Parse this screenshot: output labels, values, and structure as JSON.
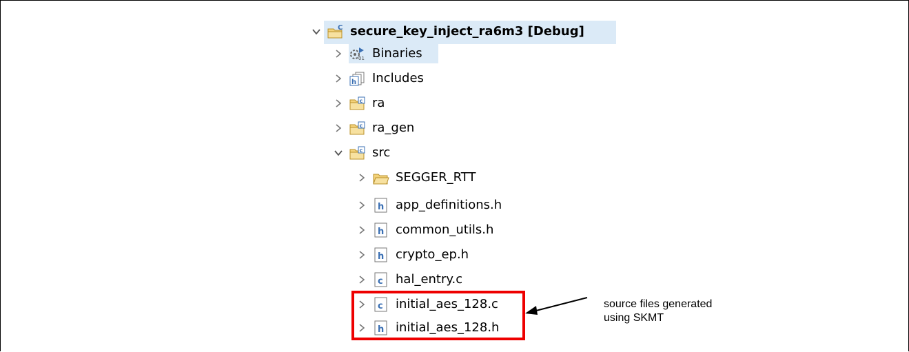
{
  "tree": {
    "root": {
      "label": "secure_key_inject_ra6m3 [Debug]",
      "icon": "c-project-icon",
      "expanded": true
    },
    "items": [
      {
        "label": "Binaries",
        "icon": "binaries-icon",
        "expanded": false
      },
      {
        "label": "Includes",
        "icon": "includes-icon",
        "expanded": false
      },
      {
        "label": "ra",
        "icon": "source-folder-icon",
        "expanded": false
      },
      {
        "label": "ra_gen",
        "icon": "source-folder-icon",
        "expanded": false
      },
      {
        "label": "src",
        "icon": "source-folder-icon",
        "expanded": true
      },
      {
        "label": "SEGGER_RTT",
        "icon": "folder-icon",
        "expanded": false
      },
      {
        "label": "app_definitions.h",
        "icon": "header-file-icon",
        "expanded": false
      },
      {
        "label": "common_utils.h",
        "icon": "header-file-icon",
        "expanded": false
      },
      {
        "label": "crypto_ep.h",
        "icon": "header-file-icon",
        "expanded": false
      },
      {
        "label": "hal_entry.c",
        "icon": "c-file-icon",
        "expanded": false
      },
      {
        "label": "initial_aes_128.c",
        "icon": "c-file-icon",
        "expanded": false
      },
      {
        "label": "initial_aes_128.h",
        "icon": "header-file-icon",
        "expanded": false
      }
    ]
  },
  "annotation": {
    "line1": "source files generated",
    "line2": "using SKMT"
  },
  "colors": {
    "selection": "#dbeaf7",
    "highlight_box": "#ee0000",
    "chevron": "#555555"
  }
}
